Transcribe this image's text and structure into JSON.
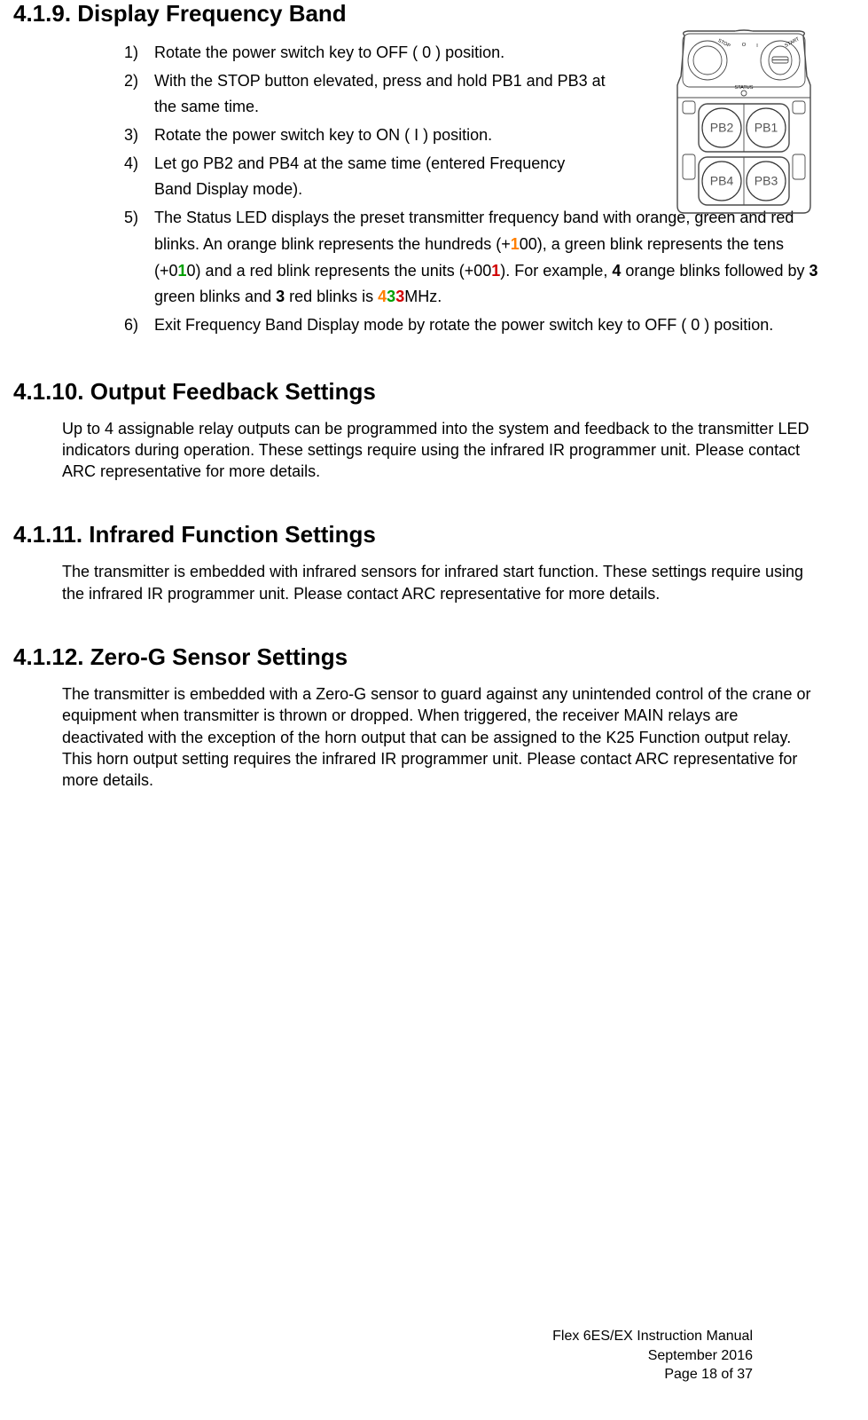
{
  "sections": {
    "s419": {
      "heading": "4.1.9. Display Frequency Band",
      "items": [
        {
          "num": "1)",
          "text_plain": "Rotate the power switch key to OFF ( 0 ) position.",
          "narrow": false
        },
        {
          "num": "2)",
          "text_plain": "With the STOP button elevated, press and hold PB1 and PB3 at the same time.",
          "narrow": true
        },
        {
          "num": "3)",
          "text_plain": "Rotate the power switch key to ON ( I ) position.",
          "narrow": false
        },
        {
          "num": "4)",
          "text_plain": "Let go PB2 and PB4 at the same time (entered Frequency Band Display mode).",
          "narrow": true
        },
        {
          "num": "5)",
          "narrow_start": true,
          "parts": [
            {
              "text": "The Status LED displays the preset transmitter frequency band with orange, green and red blinks.  An orange blink represents the hundreds (+",
              "class": ""
            },
            {
              "text": "1",
              "class": "color-orange"
            },
            {
              "text": "00), a green blink represents the tens (+0",
              "class": ""
            },
            {
              "text": "1",
              "class": "color-green"
            },
            {
              "text": "0) and a red blink represents the units (+00",
              "class": ""
            },
            {
              "text": "1",
              "class": "color-red"
            },
            {
              "text": ").  For example, ",
              "class": ""
            },
            {
              "text": "4",
              "class": "bold"
            },
            {
              "text": " orange blinks followed by ",
              "class": ""
            },
            {
              "text": "3",
              "class": "bold"
            },
            {
              "text": " green blinks and ",
              "class": ""
            },
            {
              "text": "3",
              "class": "bold"
            },
            {
              "text": " red blinks is ",
              "class": ""
            },
            {
              "text": "4",
              "class": "color-orange"
            },
            {
              "text": "3",
              "class": "color-green"
            },
            {
              "text": "3",
              "class": "color-red"
            },
            {
              "text": "MHz.",
              "class": ""
            }
          ]
        },
        {
          "num": "6)",
          "text_plain": "Exit Frequency Band Display mode by rotate the power switch key to OFF ( 0 ) position.",
          "narrow": false
        }
      ]
    },
    "s4110": {
      "heading": "4.1.10.    Output Feedback Settings",
      "para": "Up to 4 assignable relay outputs can be programmed into the system and feedback to the transmitter LED indicators during operation.  These settings require using the infrared IR programmer unit.  Please contact ARC representative for more details."
    },
    "s4111": {
      "heading": "4.1.11.    Infrared Function Settings",
      "para": "The transmitter is embedded with infrared sensors for infrared start function.  These settings require using the infrared IR programmer unit.  Please contact ARC representative for more details."
    },
    "s4112": {
      "heading": "4.1.12.    Zero-G Sensor Settings",
      "para": "The transmitter is embedded with a Zero-G sensor to guard against any unintended control of the crane or equipment when transmitter is thrown or dropped.  When triggered, the receiver MAIN relays are deactivated with the exception of the horn output that can be assigned to the K25 Function output relay.  This horn output setting requires the infrared IR programmer unit.  Please contact ARC representative for more details."
    }
  },
  "diagram": {
    "stop": "STOP",
    "start": "START",
    "status": "STATUS",
    "o": "O",
    "i": "I",
    "pb1": "PB1",
    "pb2": "PB2",
    "pb3": "PB3",
    "pb4": "PB4"
  },
  "footer": {
    "line1": "Flex 6ES/EX Instruction Manual",
    "line2": "September 2016",
    "line3": "Page 18 of 37"
  }
}
